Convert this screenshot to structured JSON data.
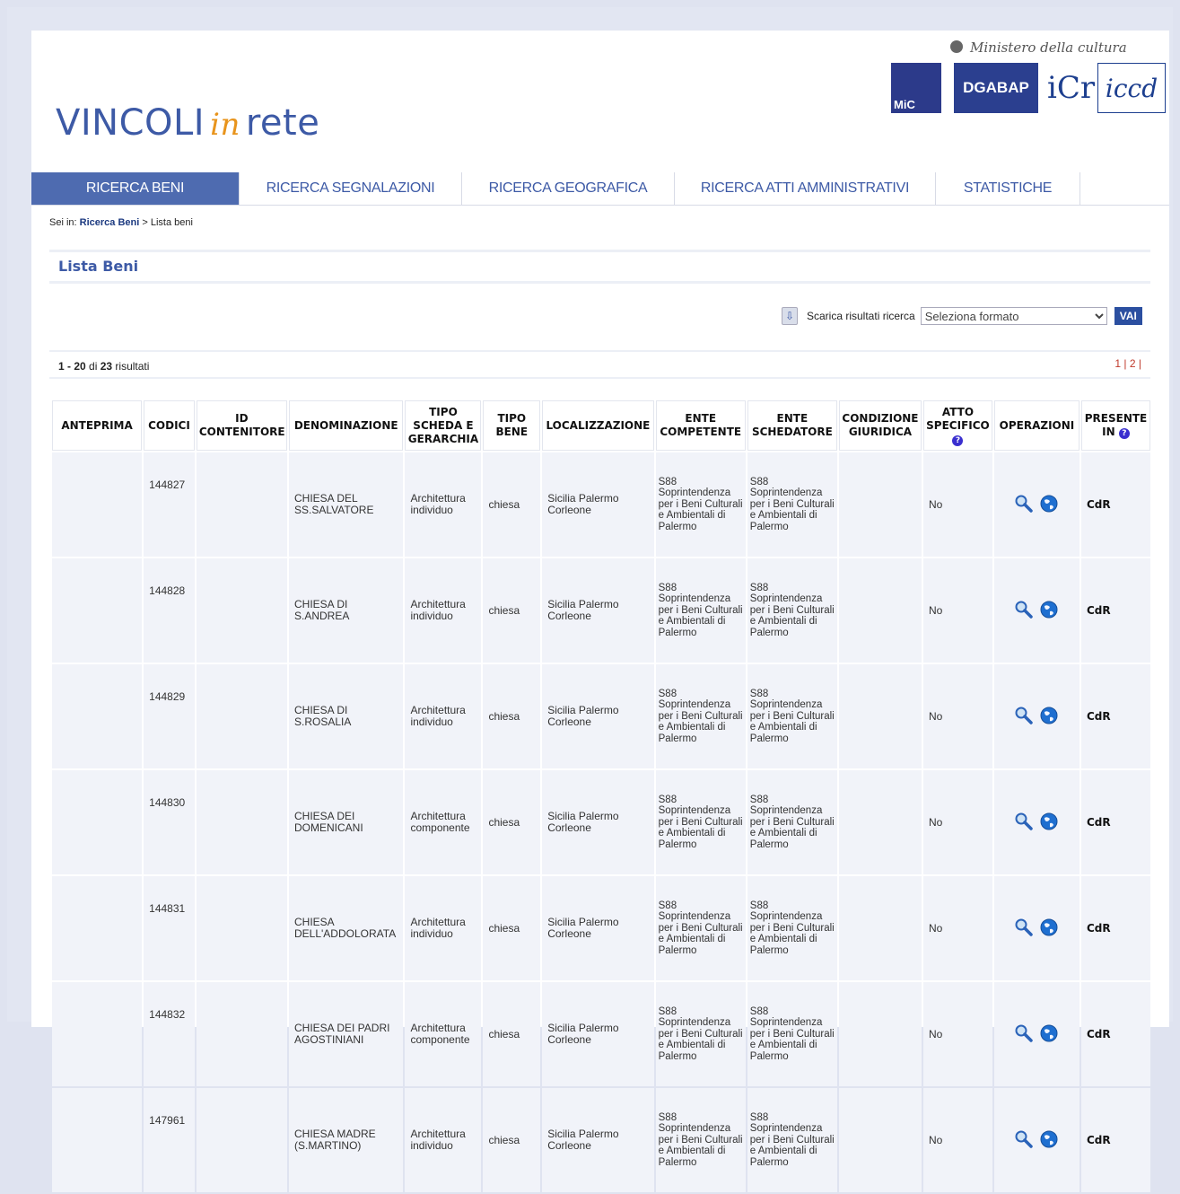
{
  "header": {
    "title_left": "VINCOLI",
    "title_in": "in",
    "title_right": "rete",
    "ministry": "Ministero della cultura",
    "logos": {
      "mic": "MiC",
      "dgabap": "DGABAP",
      "icr": "iCr",
      "iccd": "iccd"
    }
  },
  "nav": {
    "tabs": [
      {
        "label": "RICERCA BENI"
      },
      {
        "label": "RICERCA SEGNALAZIONI"
      },
      {
        "label": "RICERCA GEOGRAFICA"
      },
      {
        "label": "RICERCA ATTI AMMINISTRATIVI"
      },
      {
        "label": "STATISTICHE"
      }
    ]
  },
  "breadcrumb": {
    "prefix": "Sei in:",
    "link": "Ricerca Beni",
    "sep": ">",
    "current": "Lista beni"
  },
  "section_title": "Lista Beni",
  "download": {
    "label": "Scarica risultati ricerca",
    "select_value": "Seleziona formato",
    "button": "VAI"
  },
  "results": {
    "range": "1 - 20",
    "of": "di",
    "total": "23",
    "suffix": "risultati",
    "pages": "1 | 2 |"
  },
  "table": {
    "headers": [
      "ANTEPRIMA",
      "CODICI",
      "ID CONTENITORE",
      "DENOMINAZIONE",
      "TIPO SCHEDA E GERARCHIA",
      "TIPO BENE",
      "LOCALIZZAZIONE",
      "ENTE COMPETENTE",
      "ENTE SCHEDATORE",
      "CONDIZIONE GIURIDICA",
      "ATTO SPECIFICO",
      "OPERAZIONI",
      "PRESENTE IN"
    ],
    "rows": [
      {
        "code": "144827",
        "name": "CHIESA DEL SS.SALVATORE",
        "type": "Architettura individuo",
        "bene": "chiesa",
        "loc": "Sicilia Palermo Corleone",
        "competente": "S88 Soprintendenza per i Beni Culturali e Ambientali di Palermo",
        "schedatore": "S88 Soprintendenza per i Beni Culturali e Ambientali di Palermo",
        "atto": "No",
        "presente": "CdR"
      },
      {
        "code": "144828",
        "name": "CHIESA DI S.ANDREA",
        "type": "Architettura individuo",
        "bene": "chiesa",
        "loc": "Sicilia Palermo Corleone",
        "competente": "S88 Soprintendenza per i Beni Culturali e Ambientali di Palermo",
        "schedatore": "S88 Soprintendenza per i Beni Culturali e Ambientali di Palermo",
        "atto": "No",
        "presente": "CdR"
      },
      {
        "code": "144829",
        "name": "CHIESA DI S.ROSALIA",
        "type": "Architettura individuo",
        "bene": "chiesa",
        "loc": "Sicilia Palermo Corleone",
        "competente": "S88 Soprintendenza per i Beni Culturali e Ambientali di Palermo",
        "schedatore": "S88 Soprintendenza per i Beni Culturali e Ambientali di Palermo",
        "atto": "No",
        "presente": "CdR"
      },
      {
        "code": "144830",
        "name": "CHIESA DEI DOMENICANI",
        "type": "Architettura componente",
        "bene": "chiesa",
        "loc": "Sicilia Palermo Corleone",
        "competente": "S88 Soprintendenza per i Beni Culturali e Ambientali di Palermo",
        "schedatore": "S88 Soprintendenza per i Beni Culturali e Ambientali di Palermo",
        "atto": "No",
        "presente": "CdR"
      },
      {
        "code": "144831",
        "name": "CHIESA DELL'ADDOLORATA",
        "type": "Architettura individuo",
        "bene": "chiesa",
        "loc": "Sicilia Palermo Corleone",
        "competente": "S88 Soprintendenza per i Beni Culturali e Ambientali di Palermo",
        "schedatore": "S88 Soprintendenza per i Beni Culturali e Ambientali di Palermo",
        "atto": "No",
        "presente": "CdR"
      },
      {
        "code": "144832",
        "name": "CHIESA DEI PADRI AGOSTINIANI",
        "type": "Architettura componente",
        "bene": "chiesa",
        "loc": "Sicilia Palermo Corleone",
        "competente": "S88 Soprintendenza per i Beni Culturali e Ambientali di Palermo",
        "schedatore": "S88 Soprintendenza per i Beni Culturali e Ambientali di Palermo",
        "atto": "No",
        "presente": "CdR"
      },
      {
        "code": "147961",
        "name": "CHIESA MADRE (S.MARTINO)",
        "type": "Architettura individuo",
        "bene": "chiesa",
        "loc": "Sicilia Palermo Corleone",
        "competente": "S88 Soprintendenza per i Beni Culturali e Ambientali di Palermo",
        "schedatore": "S88 Soprintendenza per i Beni Culturali e Ambientali di Palermo",
        "atto": "No",
        "presente": "CdR"
      }
    ]
  },
  "icons": {
    "search": "magnifier-icon",
    "map": "globe-icon",
    "help": "question-icon",
    "download": "download-icon"
  }
}
